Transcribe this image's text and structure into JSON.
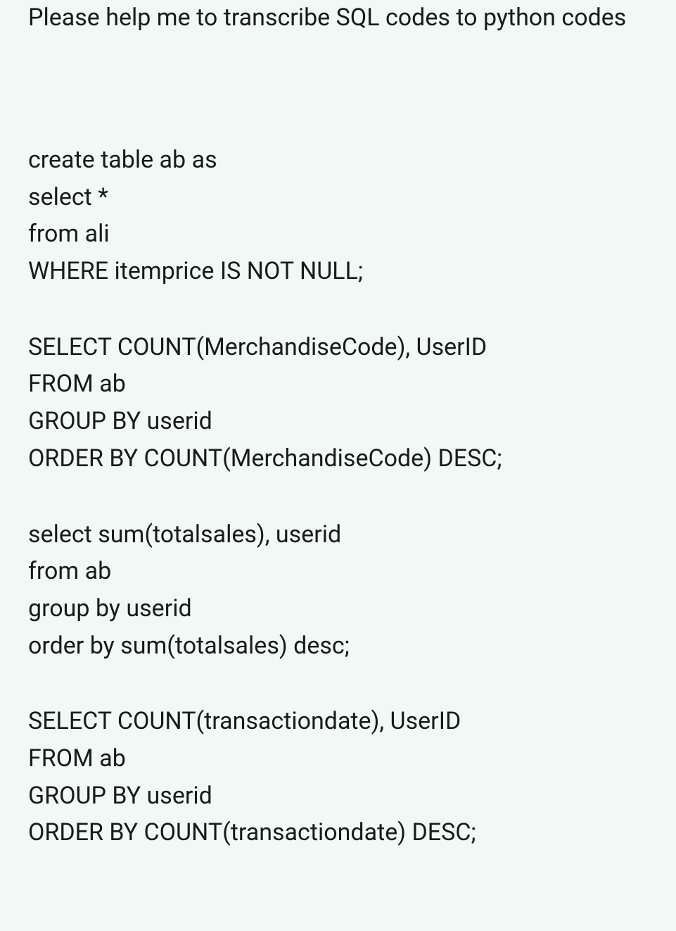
{
  "intro": "Please help me to transcribe SQL codes to python codes",
  "blocks": [
    "create table ab as\nselect *\nfrom ali\nWHERE itemprice IS NOT NULL;",
    "SELECT COUNT(MerchandiseCode), UserID\nFROM ab\nGROUP BY userid\nORDER BY COUNT(MerchandiseCode) DESC;",
    "select sum(totalsales), userid\nfrom ab\ngroup by userid\norder by sum(totalsales) desc;",
    "SELECT COUNT(transactiondate), UserID\nFROM ab\nGROUP BY userid\nORDER BY COUNT(transactiondate) DESC;"
  ]
}
